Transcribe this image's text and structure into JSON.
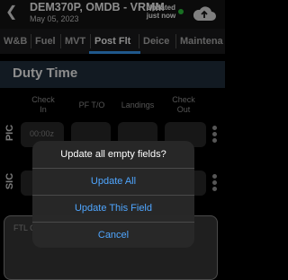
{
  "header": {
    "back_icon": "chevron-left-icon",
    "title": "DEM370P, OMDB - VRMM",
    "date": "May 05, 2023",
    "update_status_line1": "Updated",
    "update_status_line2": "just now",
    "status_dot_color": "#2ecc40",
    "sync_icon": "cloud-upload-icon"
  },
  "tabs": [
    {
      "label": "W&B",
      "active": false
    },
    {
      "label": "Fuel",
      "active": false
    },
    {
      "label": "MVT",
      "active": false
    },
    {
      "label": "Post Flt",
      "active": true
    },
    {
      "label": "Deice",
      "active": false
    },
    {
      "label": "Maintena",
      "active": false
    }
  ],
  "section": {
    "title": "Duty Time"
  },
  "columns": {
    "check_in_line1": "Check",
    "check_in_line2": "In",
    "pf_to": "PF T/O",
    "landings": "Landings",
    "check_out_line1": "Check",
    "check_out_line2": "Out"
  },
  "rows": {
    "pic": {
      "label": "PIC",
      "check_in_placeholder": "00:00z"
    },
    "sic": {
      "label": "SIC"
    }
  },
  "ftl": {
    "label": "FTL C"
  },
  "dialog": {
    "title": "Update all empty fields?",
    "update_all": "Update All",
    "update_this": "Update This Field",
    "cancel": "Cancel"
  },
  "colors": {
    "accent": "#4fa6ff",
    "tab_underline": "#3aa0ff",
    "section_bg": "#22313f"
  }
}
